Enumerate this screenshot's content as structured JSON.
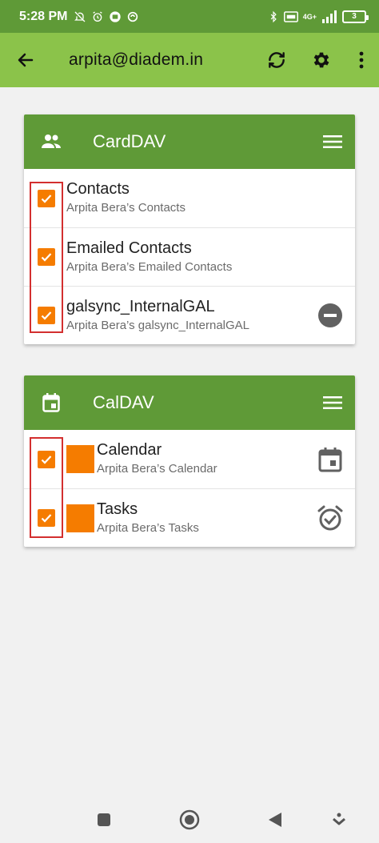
{
  "status_bar": {
    "time": "5:28 PM",
    "battery": "3",
    "network": "4G+"
  },
  "toolbar": {
    "title": "arpita@diadem.in",
    "back_icon": "arrow-left-icon",
    "sync_icon": "sync-icon",
    "settings_icon": "gear-icon",
    "more_icon": "more-vert-icon"
  },
  "carddav": {
    "title": "CardDAV",
    "header_icon": "people-icon",
    "menu_icon": "menu-icon",
    "items": [
      {
        "name": "Contacts",
        "description": "Arpita Bera’s Contacts",
        "checked": true
      },
      {
        "name": "Emailed Contacts",
        "description": "Arpita Bera’s Emailed Contacts",
        "checked": true
      },
      {
        "name": "galsync_InternalGAL",
        "description": "Arpita Bera’s galsync_InternalGAL",
        "checked": true,
        "right_icon": "remove-circle-icon"
      }
    ]
  },
  "caldav": {
    "title": "CalDAV",
    "header_icon": "calendar-icon",
    "menu_icon": "menu-icon",
    "items": [
      {
        "name": "Calendar",
        "description": "Arpita Bera’s Calendar",
        "checked": true,
        "color": "#f57c00",
        "right_icon": "event-icon"
      },
      {
        "name": "Tasks",
        "description": "Arpita Bera’s Tasks",
        "checked": true,
        "color": "#f57c00",
        "right_icon": "alarm-icon"
      }
    ]
  },
  "colors": {
    "status_bar": "#5f9a37",
    "toolbar": "#8bc34a",
    "card_header": "#5f9a37",
    "checkbox": "#f57c00",
    "highlight": "#d32f2f"
  }
}
